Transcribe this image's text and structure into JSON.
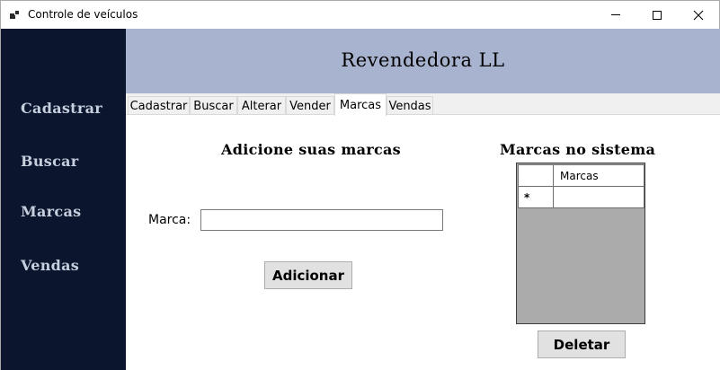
{
  "window": {
    "title": "Controle de veículos"
  },
  "sidebar": {
    "items": [
      {
        "label": "Cadastrar"
      },
      {
        "label": "Buscar"
      },
      {
        "label": "Marcas"
      },
      {
        "label": "Vendas"
      }
    ]
  },
  "header": {
    "title": "Revendedora LL"
  },
  "tabs": [
    {
      "label": "Cadastrar"
    },
    {
      "label": "Buscar"
    },
    {
      "label": "Alterar"
    },
    {
      "label": "Vender"
    },
    {
      "label": "Marcas",
      "active": true
    },
    {
      "label": "Vendas"
    }
  ],
  "form": {
    "heading": "Adicione suas marcas",
    "marca_label": "Marca:",
    "marca_value": "",
    "add_button": "Adicionar"
  },
  "list": {
    "heading": "Marcas no sistema",
    "column_header": "Marcas",
    "new_row_marker": "*",
    "delete_button": "Deletar"
  },
  "colors": {
    "sidebar_bg": "#0b162e",
    "header_bg": "#a8b3cf",
    "sidebar_text": "#c7cede"
  }
}
